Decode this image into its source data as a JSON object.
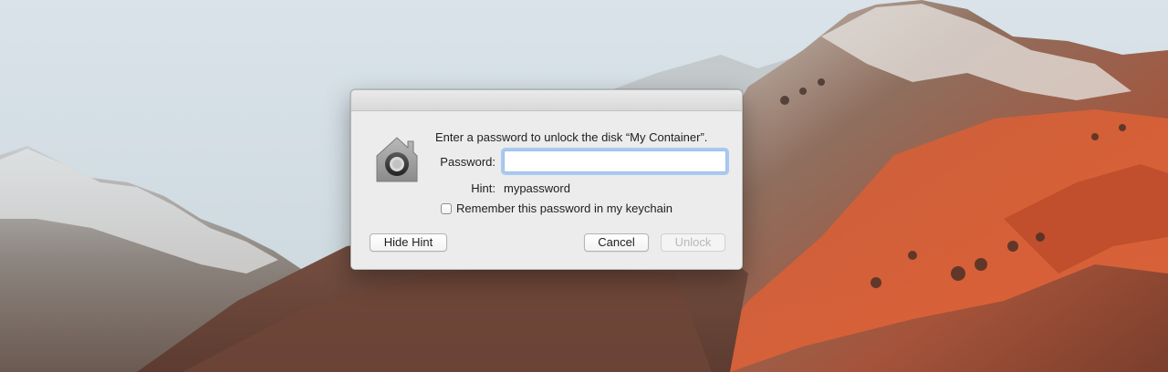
{
  "dialog": {
    "message": "Enter a password to unlock the disk “My Container”.",
    "password_label": "Password:",
    "password_value": "",
    "hint_label": "Hint:",
    "hint_value": "mypassword",
    "remember_label": "Remember this password in my keychain",
    "remember_checked": false,
    "buttons": {
      "hide_hint": "Hide Hint",
      "cancel": "Cancel",
      "unlock": "Unlock"
    },
    "icon": "home-lock-icon"
  },
  "wallpaper": "mountain-landscape"
}
